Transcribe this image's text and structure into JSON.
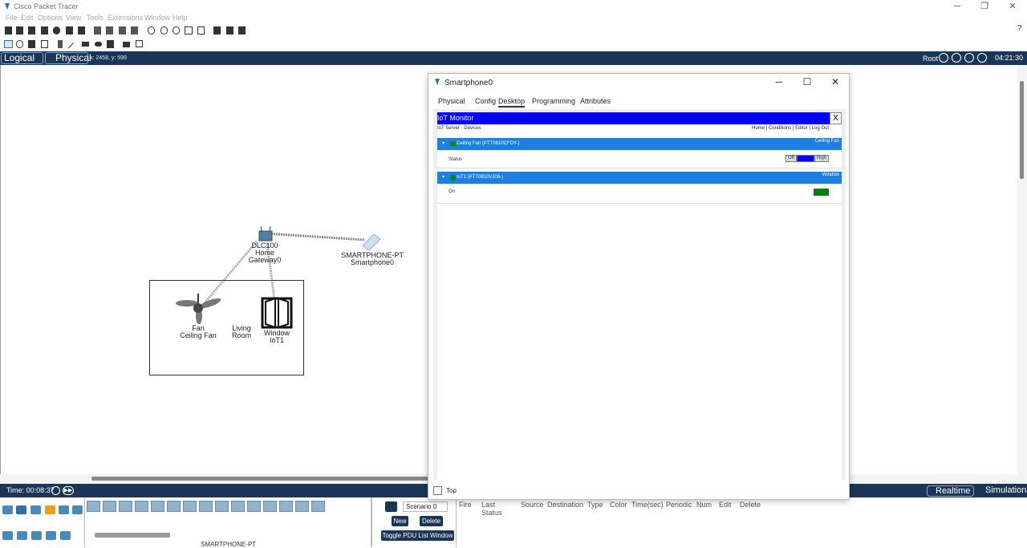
{
  "window": {
    "title": "Cisco Packet Tracer",
    "minimize": "─",
    "maximize": "❐",
    "close": "✕"
  },
  "menu": [
    "File",
    "Edit",
    "Options",
    "View",
    "Tools",
    "Extensions",
    "Window",
    "Help"
  ],
  "help_icon": "?",
  "topbar": {
    "logical": "Logical",
    "physical": "Physical",
    "coords": "x: 2458, y: 599",
    "root": "Root",
    "clock": "04:21:30"
  },
  "canvas": {
    "gateway": {
      "model": "DLC100",
      "name": "Home Gateway0"
    },
    "smartphone": {
      "model": "SMARTPHONE-PT",
      "name": "Smartphone0"
    },
    "fan": {
      "type": "Fan",
      "name": "Ceiling Fan"
    },
    "room_label": "Living Room",
    "window_dev": {
      "type": "Window",
      "name": "IoT1"
    }
  },
  "statusbar": {
    "time": "Time: 00:08:37",
    "realtime": "Realtime",
    "simulation": "Simulation"
  },
  "bottom": {
    "selected_device": "SMARTPHONE-PT",
    "scenario": "Scenario 0",
    "new": "New",
    "delete": "Delete",
    "toggle_pdu": "Toggle PDU List Window",
    "pdu_columns": [
      "Fire",
      "Last Status",
      "Source",
      "Destination",
      "Type",
      "Color",
      "Time(sec)",
      "Periodic",
      "Num",
      "Edit",
      "Delete"
    ]
  },
  "dialog": {
    "title": "Smartphone0",
    "tabs": [
      "Physical",
      "Config",
      "Desktop",
      "Programming",
      "Attributes"
    ],
    "active_tab": "Desktop",
    "top_checkbox": "Top",
    "iot": {
      "title": "IoT Monitor",
      "close": "X",
      "subtitle": "IoT Server - Devices",
      "nav": "Home | Conditions | Editor | Log Out",
      "devices": [
        {
          "name": "Ceiling Fan (PTT0810CFDY-)",
          "type": "Ceiling Fan",
          "prop_label": "Status",
          "off": "Off",
          "high": "High"
        },
        {
          "name": "IoT1 (PTT0810VJ08-)",
          "type": "Window",
          "prop_label": "On",
          "status_color": "#008000"
        }
      ]
    }
  },
  "colors": {
    "navy": "#1b3557",
    "iot_header": "#0000ff",
    "device_bar": "#1e7fe0",
    "on_green": "#008000"
  }
}
